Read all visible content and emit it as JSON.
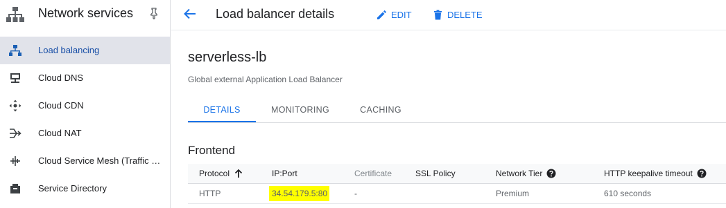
{
  "sidebar": {
    "title": "Network services",
    "items": [
      {
        "label": "Load balancing",
        "icon": "load-balancing-icon",
        "active": true
      },
      {
        "label": "Cloud DNS",
        "icon": "cloud-dns-icon"
      },
      {
        "label": "Cloud CDN",
        "icon": "cloud-cdn-icon"
      },
      {
        "label": "Cloud NAT",
        "icon": "cloud-nat-icon"
      },
      {
        "label": "Cloud Service Mesh (Traffic …",
        "icon": "service-mesh-icon"
      },
      {
        "label": "Service Directory",
        "icon": "service-directory-icon"
      }
    ]
  },
  "header": {
    "title": "Load balancer details",
    "edit_label": "EDIT",
    "delete_label": "DELETE"
  },
  "load_balancer": {
    "name": "serverless-lb",
    "type": "Global external Application Load Balancer"
  },
  "tabs": [
    {
      "label": "DETAILS",
      "active": true
    },
    {
      "label": "MONITORING"
    },
    {
      "label": "CACHING"
    }
  ],
  "frontend": {
    "title": "Frontend",
    "columns": [
      "Protocol",
      "IP:Port",
      "Certificate",
      "SSL Policy",
      "Network Tier",
      "HTTP keepalive timeout"
    ],
    "rows": [
      [
        "HTTP",
        "34.54.179.5:80",
        "-",
        "",
        "Premium",
        "610 seconds"
      ]
    ]
  },
  "colors": {
    "accent": "#1a73e8",
    "active_nav_bg": "#e1e3ea",
    "highlight": "#ffff00"
  }
}
